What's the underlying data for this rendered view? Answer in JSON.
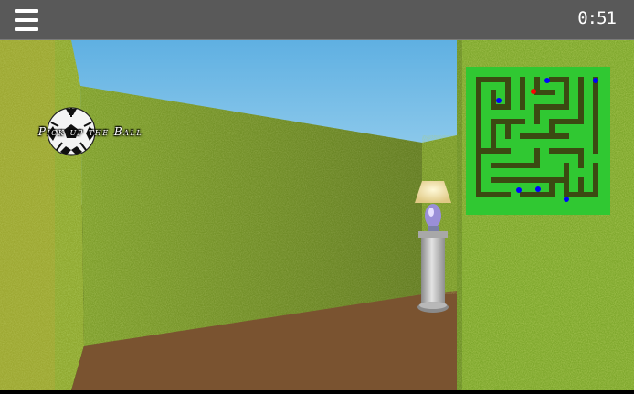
{
  "header": {
    "menu_icon": "hamburger-menu-icon",
    "timer": "0:51"
  },
  "hud": {
    "objective_text": "Pick up the Ball",
    "objective_icon": "soccer-ball-icon"
  },
  "colors": {
    "topbar": "#595959",
    "sky": "#7fc5ec",
    "hedge": "#7c9a2b",
    "floor": "#7a5330",
    "minimap_wall": "#2bc52b",
    "minimap_path": "#3a4a12",
    "minimap_player": "#ff0000",
    "minimap_item": "#0000ff"
  }
}
